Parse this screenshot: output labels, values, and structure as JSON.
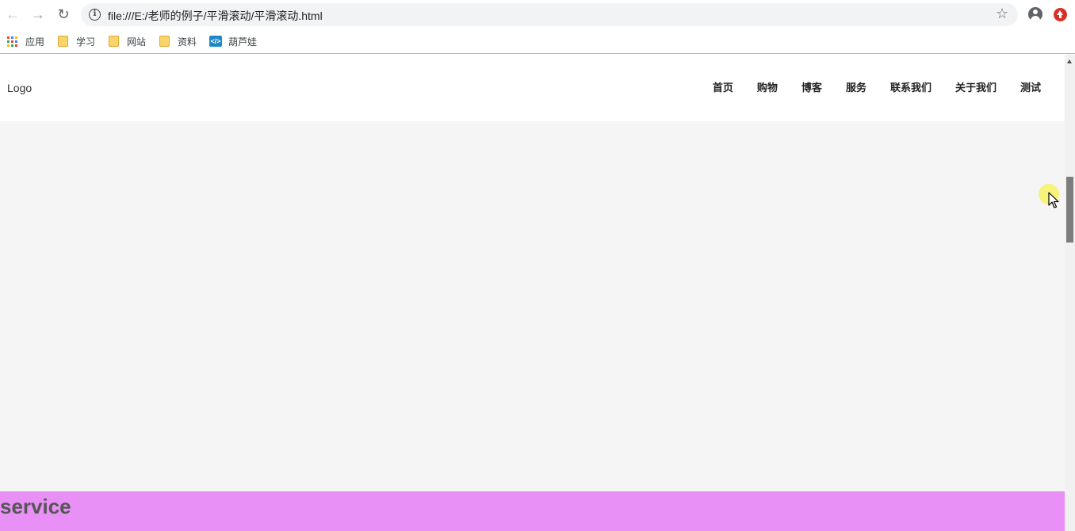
{
  "browser": {
    "url": "file:///E:/老师的例子/平滑滚动/平滑滚动.html",
    "icons": [
      "back-icon",
      "forward-icon",
      "reload-icon",
      "info-icon",
      "star-icon",
      "account-icon",
      "update-icon"
    ]
  },
  "bookmarks": [
    {
      "label": "应用",
      "icon": "apps-icon"
    },
    {
      "label": "学习",
      "icon": "folder-icon"
    },
    {
      "label": "网站",
      "icon": "folder-icon"
    },
    {
      "label": "资料",
      "icon": "folder-icon"
    },
    {
      "label": "葫芦娃",
      "icon": "hulu-icon"
    }
  ],
  "page": {
    "logo": "Logo",
    "menu": [
      "首页",
      "购物",
      "博客",
      "服务",
      "联系我们",
      "关于我们",
      "测试"
    ],
    "service_title": "service",
    "colors": {
      "content_bg": "#f5f5f5",
      "service_bg": "#e990f7",
      "header_bg": "#ffffff"
    }
  }
}
